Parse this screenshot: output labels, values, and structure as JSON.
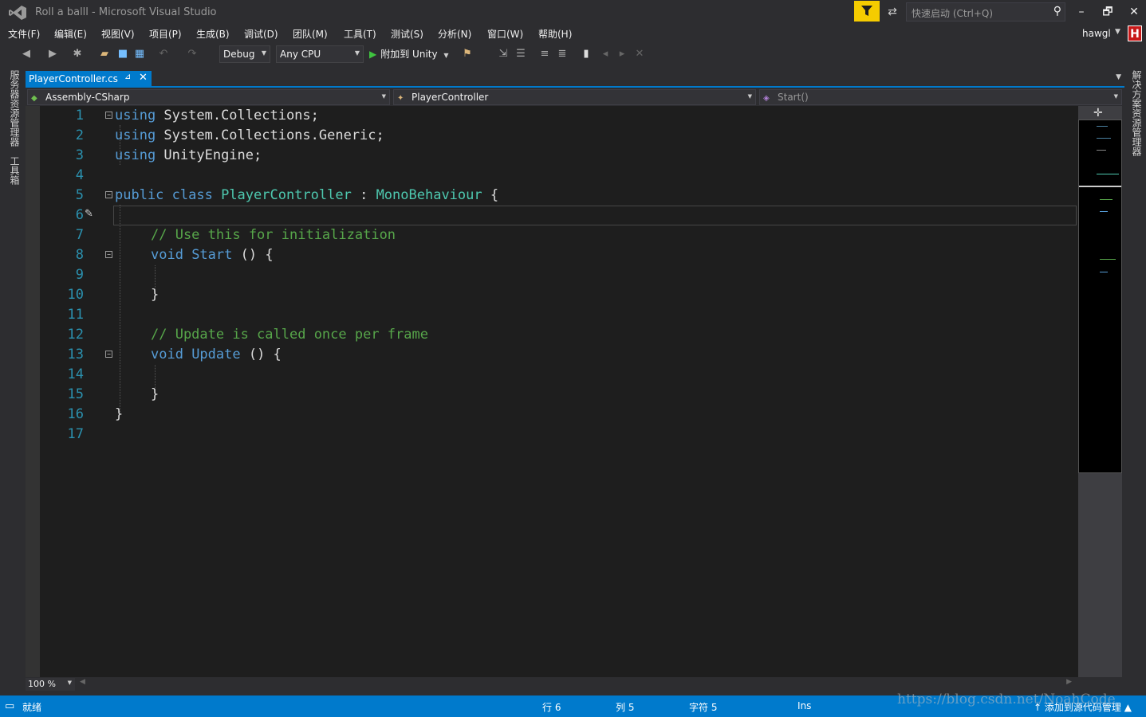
{
  "window": {
    "title": "Roll a balll - Microsoft Visual Studio",
    "quick_launch_placeholder": "快速启动 (Ctrl+Q)",
    "user": "hawgl",
    "user_badge": "H",
    "minimize": "–",
    "restore": "🗗",
    "close": "✕"
  },
  "menu": [
    "文件(F)",
    "编辑(E)",
    "视图(V)",
    "项目(P)",
    "生成(B)",
    "调试(D)",
    "团队(M)",
    "工具(T)",
    "测试(S)",
    "分析(N)",
    "窗口(W)",
    "帮助(H)"
  ],
  "toolbar": {
    "config": "Debug",
    "platform": "Any CPU",
    "attach_label": "附加到 Unity",
    "icons": [
      "back-icon",
      "forward-icon",
      "new-project-icon",
      "open-file-icon",
      "save-icon",
      "save-all-icon",
      "undo-icon",
      "redo-icon",
      "find-icon",
      "step-icon",
      "comment-icon",
      "uncomment-icon",
      "bookmark-icon",
      "prev-bookmark-icon",
      "next-bookmark-icon",
      "clear-bookmark-icon"
    ]
  },
  "side_panels": {
    "left_top": "服务器资源管理器",
    "left_bottom": "工具箱",
    "right": "解决方案资源管理器"
  },
  "tab": {
    "label": "PlayerController.cs",
    "pin": "⊿",
    "close": "✕"
  },
  "navbar": {
    "project": "Assembly-CSharp",
    "class": "PlayerController",
    "member": "Start()"
  },
  "code_lines": [
    {
      "n": "1"
    },
    {
      "n": "2"
    },
    {
      "n": "3"
    },
    {
      "n": "4"
    },
    {
      "n": "5"
    },
    {
      "n": "6"
    },
    {
      "n": "7"
    },
    {
      "n": "8"
    },
    {
      "n": "9"
    },
    {
      "n": "10"
    },
    {
      "n": "11"
    },
    {
      "n": "12"
    },
    {
      "n": "13"
    },
    {
      "n": "14"
    },
    {
      "n": "15"
    },
    {
      "n": "16"
    },
    {
      "n": "17"
    }
  ],
  "code": {
    "using": "using",
    "ns1": " System.Collections;",
    "ns2": " System.Collections.Generic;",
    "ns3": " UnityEngine;",
    "public": "public",
    "class": " class ",
    "classname": "PlayerController",
    "colon": " : ",
    "base": "MonoBehaviour",
    "brace_open": " {",
    "comment1": "// Use this for initialization",
    "void": "void",
    "start": " Start",
    "update": " Update",
    "parens": " () {",
    "close": "}",
    "comment2": "// Update is called once per frame"
  },
  "zoom": "100 %",
  "status": {
    "ready": "就绪",
    "line": "行 6",
    "col": "列 5",
    "char": "字符 5",
    "mode": "Ins",
    "source_control": "添加到源代码管理"
  },
  "watermark": "https://blog.csdn.net/NoahCode",
  "colors": {
    "accent": "#007acc",
    "keyword": "#569cd6",
    "type": "#4ec9b0",
    "comment": "#57a64a",
    "line_number": "#2b91af"
  }
}
